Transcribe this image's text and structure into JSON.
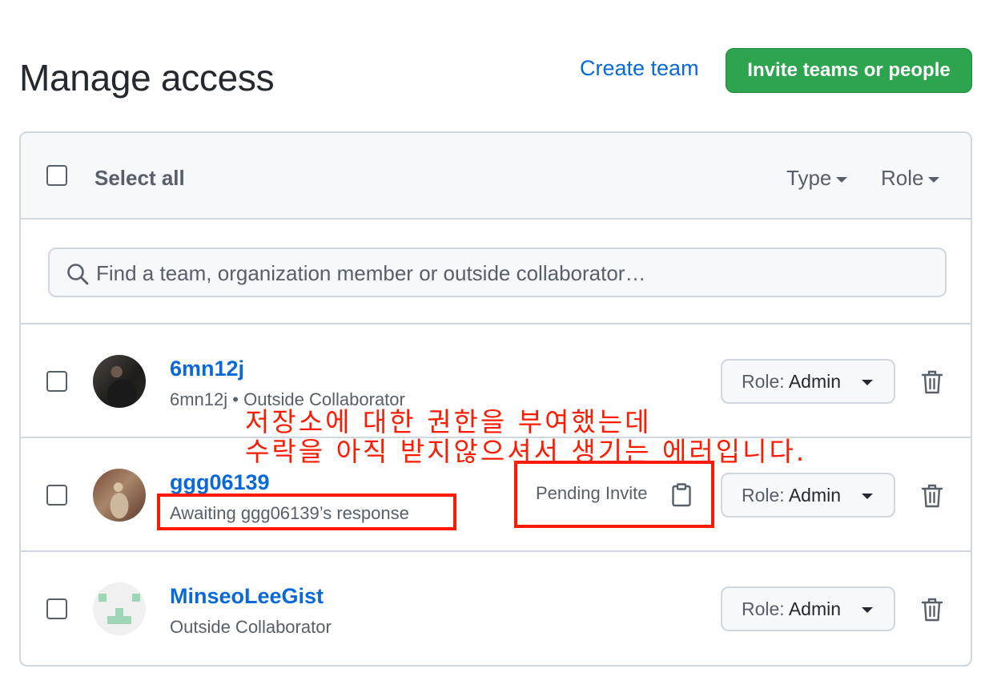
{
  "header": {
    "title": "Manage access",
    "create_team_label": "Create team",
    "invite_label": "Invite teams or people"
  },
  "list_header": {
    "select_all_label": "Select all",
    "type_filter_label": "Type",
    "role_filter_label": "Role"
  },
  "search": {
    "placeholder": "Find a team, organization member or outside collaborator…"
  },
  "members": [
    {
      "username": "6mn12j",
      "subtitle": "6mn12j • Outside Collaborator",
      "role_prefix": "Role:",
      "role_value": "Admin"
    },
    {
      "username": "ggg06139",
      "subtitle": "Awaiting ggg06139’s response",
      "pending_label": "Pending Invite",
      "role_prefix": "Role:",
      "role_value": "Admin"
    },
    {
      "username": "MinseoLeeGist",
      "subtitle": "Outside Collaborator",
      "role_prefix": "Role:",
      "role_value": "Admin"
    }
  ],
  "annotation": {
    "line1": "저장소에 대한 권한을 부여했는데",
    "line2": "수락을 아직 받지않으셔서 생기는 에러입니다.",
    "color": "#ff1a00"
  },
  "colors": {
    "link": "#0969da",
    "primary_button": "#2da44e",
    "border": "#d0d7de",
    "header_bg": "#f6f8fa",
    "muted_text": "#57606a"
  },
  "icons": [
    "search-icon",
    "caret-down-icon",
    "trash-icon",
    "clipboard-icon",
    "avatar"
  ]
}
